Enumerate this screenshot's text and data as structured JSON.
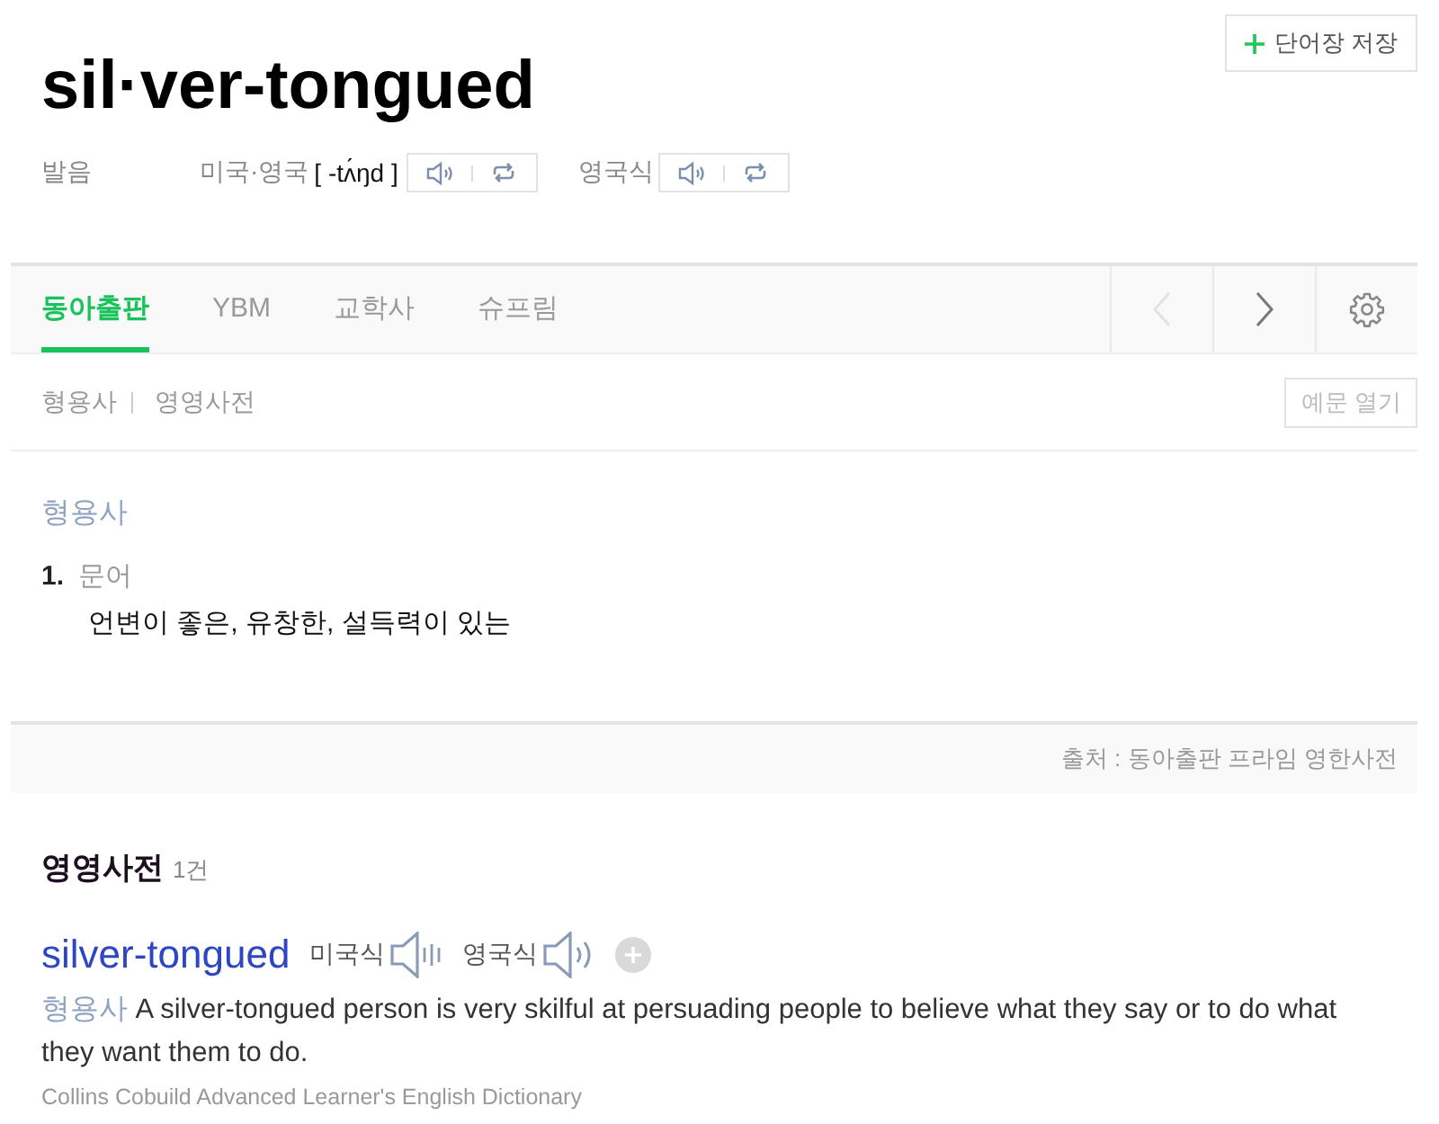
{
  "save_button": {
    "label": "단어장 저장"
  },
  "headword": "sil·ver-tongued",
  "pronunciation": {
    "label": "발음",
    "variants": [
      {
        "label": "미국·영국",
        "ipa": "[ -tʌ́ŋd ]"
      },
      {
        "label": "영국식"
      }
    ]
  },
  "tabs": [
    {
      "label": "동아출판",
      "selected": true
    },
    {
      "label": "YBM",
      "selected": false
    },
    {
      "label": "교학사",
      "selected": false
    },
    {
      "label": "슈프림",
      "selected": false
    }
  ],
  "nav_buttons": [
    {
      "kind": "prev",
      "disabled": true
    },
    {
      "kind": "next",
      "disabled": false
    }
  ],
  "filters": [
    "형용사",
    "영영사전"
  ],
  "example_toggle": {
    "label": "예문 열기"
  },
  "entry": {
    "pos": "형용사",
    "senses": [
      {
        "number": "1.",
        "register": "문어",
        "definition": "언변이 좋은, 유창한, 설득력이 있는"
      }
    ]
  },
  "source": "출처 : 동아출판 프라임 영한사전",
  "english_section": {
    "title": "영영사전",
    "count": "1건",
    "entries": [
      {
        "word": "silver-tongued",
        "audio": [
          {
            "label": "미국식",
            "kind": "bars"
          },
          {
            "label": "영국식",
            "kind": "arcs"
          }
        ],
        "pos": "형용사",
        "definition": "A silver-tongued person is very skilful at persuading people to believe what they say or to do what they want them to do.",
        "source": "Collins Cobuild Advanced Learner's English Dictionary"
      }
    ]
  }
}
